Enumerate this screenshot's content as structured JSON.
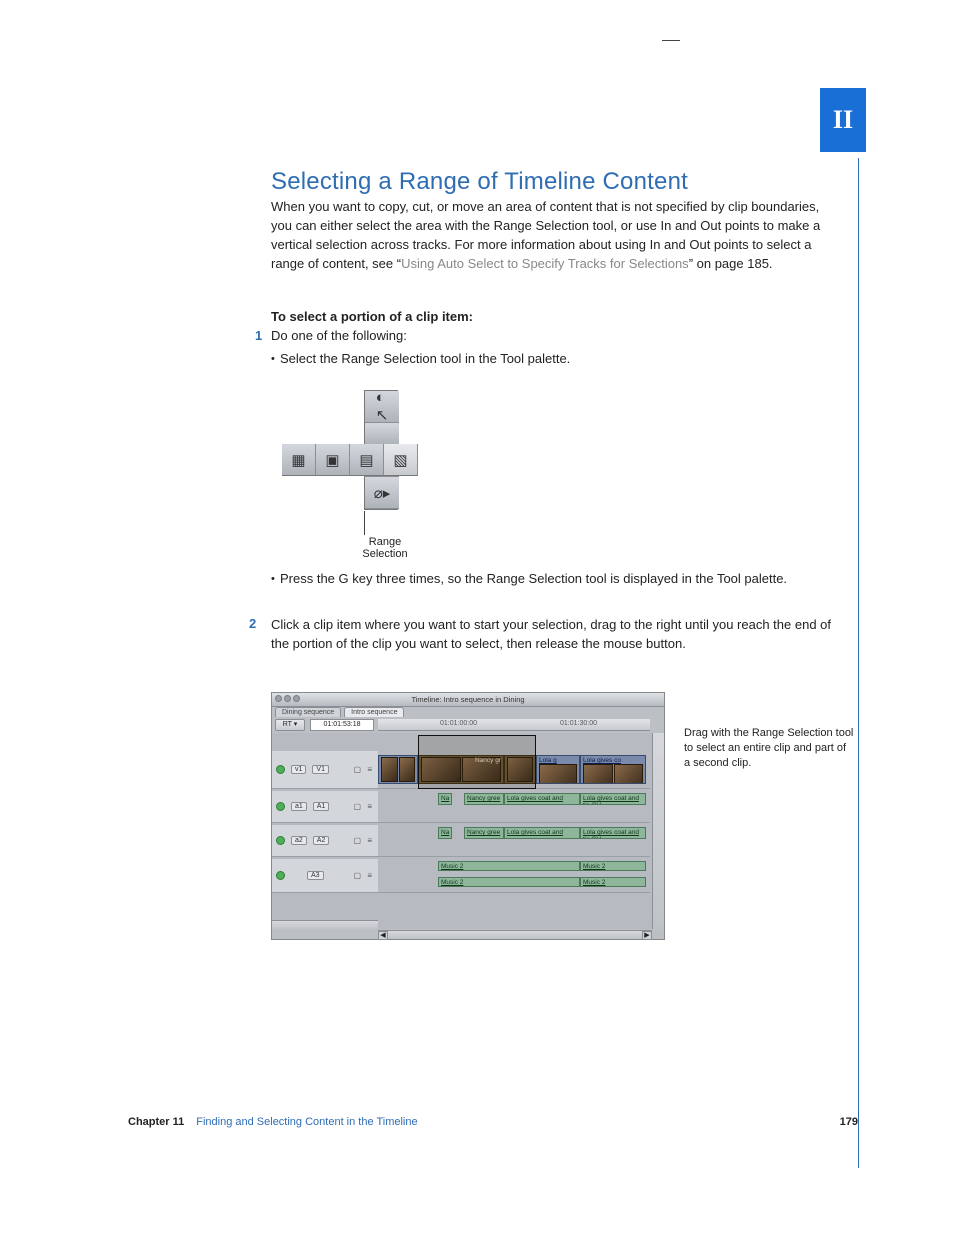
{
  "part_tab": "II",
  "heading": "Selecting a Range of Timeline Content",
  "intro": {
    "pre": "When you want to copy, cut, or move an area of content that is not specified by clip boundaries, you can either select the area with the Range Selection tool, or use In and Out points to make a vertical selection across tracks. For more information about using In and Out points to select a range of content, see “",
    "xref": "Using Auto Select to Specify Tracks for Selections",
    "post": "” on page 185."
  },
  "subhead": "To select a portion of a clip item:",
  "steps": {
    "s1_num": "1",
    "s1_text": "Do one of the following:",
    "s1_b1": "Select the Range Selection tool in the Tool palette.",
    "s1_b2": "Press the G key three times, so the Range Selection tool is displayed in the Tool palette.",
    "s2_num": "2",
    "s2_text": "Click a clip item where you want to start your selection, drag to the right until you reach the end of the portion of the clip you want to select, then release the mouse button."
  },
  "fig1": {
    "caption": "Range Selection",
    "tool_arrow": "➤",
    "tool_range1": "▦",
    "tool_range2": "▣",
    "tool_range3": "▤",
    "tool_range_sel": "▧"
  },
  "fig2": {
    "title": "Timeline: Intro sequence in Dining",
    "tab_a": "Dining sequence",
    "tab_b": "Intro sequence",
    "rt": "RT ▾",
    "cur_tc": "01:01:53:18",
    "tc1": "01:01:00:00",
    "tc2": "01:01:30:00",
    "v1_src": "v1",
    "v1_dst": "V1",
    "a1_src": "a1",
    "a1_dst": "A1",
    "a2_src": "a2",
    "a2_dst": "A2",
    "a3_dst": "A3",
    "lock": "□",
    "mute": "♫",
    "clip_nancy_gr": "Nancy gr",
    "clip_lola_g": "Lola g",
    "clip_lola_gives_co": "Lola gives co",
    "clip_na": "Na",
    "clip_nancy_gree": "Nancy gree",
    "clip_lola_gives_coat_and": "Lola gives coat and",
    "clip_lola_gives_coat_and_tie_cu": "Lola gives coat and tie CU",
    "clip_music2": "Music 2",
    "caption": "Drag with the Range Selection tool to select an entire clip and part of a second clip."
  },
  "footer": {
    "chapter": "Chapter 11",
    "title": "Finding and Selecting Content in the Timeline",
    "page": "179"
  }
}
